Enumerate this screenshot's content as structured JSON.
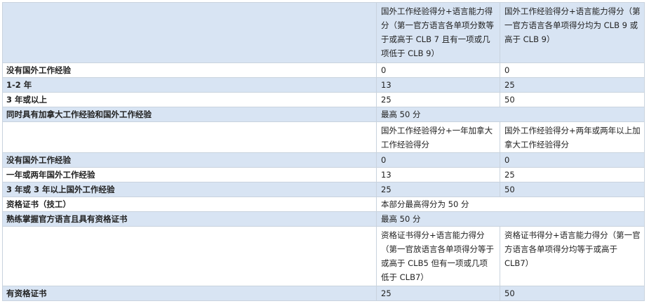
{
  "rows": [
    {
      "label": "",
      "c2": "国外工作经验得分+语言能力得分（第一官方语言各单项分数等于或高于 CLB  7 且有一项或几项低于 CLB 9）",
      "c3": "国外工作经验得分+语言能力得分（第一官方语言各单项得分均为 CLB 9 或高于 CLB 9）"
    },
    {
      "label": "没有国外工作经验",
      "c2": "0",
      "c3": "0"
    },
    {
      "label": "1-2 年",
      "c2": "13",
      "c3": "25"
    },
    {
      "label": "3 年或以上",
      "c2": "25",
      "c3": "50"
    },
    {
      "label": "同时具有加拿大工作经验和国外工作经验",
      "span": "最高 50 分"
    },
    {
      "label": "",
      "c2": "国外工作经验得分+一年加拿大工作经验得分",
      "c3": "国外工作经验得分+两年或两年以上加拿大工作经验得分"
    },
    {
      "label": "没有国外工作经验",
      "c2": "0",
      "c3": "0"
    },
    {
      "label": "一年或两年国外工作经验",
      "c2": "13",
      "c3": "25"
    },
    {
      "label": "3 年或 3 年以上国外工作经验",
      "c2": "25",
      "c3": "50"
    },
    {
      "label": "资格证书（技工）",
      "span": "本部分最高得分为 50 分"
    },
    {
      "label": "熟练掌握官方语言且具有资格证书",
      "span": "最高 50 分"
    },
    {
      "label": "",
      "c2": "资格证书得分+语言能力得分（第一官放语言各单项得分等于或高于 CLB5 但有一项或几项低于 CLB7）",
      "c3": "资格证书得分+语言能力得分（第一官方语言各单项得分均等于或高于 CLB7）"
    },
    {
      "label": "有资格证书",
      "c2": "25",
      "c3": "50"
    }
  ]
}
